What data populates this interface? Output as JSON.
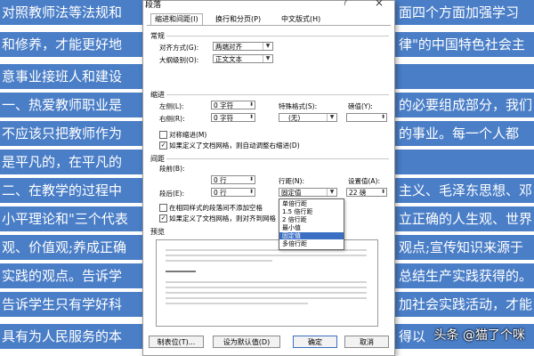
{
  "document": {
    "lines": [
      {
        "left": "对照教师法等法规和",
        "right": "面四个方面加强学习"
      },
      {
        "left": "和修养，才能更好地",
        "right": "律\"的中国特色社会主"
      },
      {
        "left": "意事业接班人和建设",
        "right": ""
      },
      {
        "left": "一、热爱教师职业是",
        "right": "的必要组成部分，我们"
      },
      {
        "left": "不应该只把教师作为",
        "right": "的事业。每一个人都"
      },
      {
        "left": "是平凡的，在平凡的",
        "right": ""
      },
      {
        "left": "二、在教学的过程中",
        "right": "主义、毛泽东思想、邓"
      },
      {
        "left": "小平理论和\"三个代表",
        "right": "立正确的人生观、世界"
      },
      {
        "left": "观、价值观;养成正确",
        "right": "观点;宣传知识来源于"
      },
      {
        "left": "实践的观点。告诉学",
        "right": "总结生产实践获得的。"
      },
      {
        "left": "告诉学生只有学好科",
        "right": "加社会实践活动，才能"
      },
      {
        "left": "具有为人民服务的本",
        "right": "得以"
      }
    ],
    "watermark": "头条 @猫了个咪"
  },
  "dialog": {
    "title": "段落",
    "help": "?",
    "close": "×",
    "tabs": [
      "缩进和间距(I)",
      "换行和分页(P)",
      "中文版式(H)"
    ],
    "general": {
      "heading": "常规",
      "alignment_label": "对齐方式(G):",
      "alignment_value": "两端对齐",
      "outline_label": "大纲级别(O):",
      "outline_value": "正文文本"
    },
    "indent": {
      "heading": "缩进",
      "left_label": "左侧(L):",
      "left_value": "0 字符",
      "right_label": "右侧(R):",
      "right_value": "0 字符",
      "special_label": "特殊格式(S):",
      "special_value": "(无)",
      "by_label": "磅值(Y):",
      "by_value": "",
      "mirror_label": "对称缩进(M)",
      "grid_label": "如果定义了文档网格，则自动调整右缩进(D)"
    },
    "spacing": {
      "heading": "间距",
      "before_label": "段前(B):",
      "before_value": "0 行",
      "after_label": "段后(E):",
      "after_value": "0 行",
      "linespacing_label": "行距(N):",
      "linespacing_value": "固定值",
      "at_label": "设置值(A):",
      "at_value": "22 磅",
      "no_space_label": "在相同样式的段落间不添加空格",
      "snap_label": "如果定义了文档网格，则对齐到网格",
      "options": [
        "单倍行距",
        "1.5 倍行距",
        "2 倍行距",
        "最小值",
        "固定值",
        "多倍行距"
      ],
      "selected_index": 4
    },
    "preview": {
      "heading": "预览"
    },
    "buttons": {
      "tabs": "制表位(T)...",
      "default": "设为默认值(D)",
      "ok": "确定",
      "cancel": "取消"
    }
  }
}
